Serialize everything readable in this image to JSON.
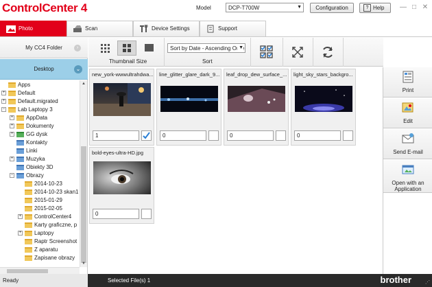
{
  "window": {
    "title_main": "ControlCenter",
    "title_version": " 4",
    "model_label": "Model",
    "model_value": "DCP-T700W",
    "configuration_label": "Configuration",
    "help_label": "Help",
    "help_glyph": "?",
    "minimize_glyph": "—",
    "maximize_glyph": "□",
    "close_glyph": "✕"
  },
  "tabs": [
    {
      "label": "Photo",
      "icon": "photo-icon",
      "active": true
    },
    {
      "label": "Scan",
      "icon": "scan-icon",
      "active": false
    },
    {
      "label": "Device Settings",
      "icon": "tools-icon",
      "active": false
    },
    {
      "label": "Support",
      "icon": "support-icon",
      "active": false
    }
  ],
  "leftpanel": {
    "cc4_folder": "My CC4 Folder",
    "desktop": "Desktop",
    "tree": [
      {
        "label": "Apps",
        "expander": "",
        "folder": "yellow"
      },
      {
        "label": "Default",
        "expander": "+",
        "folder": "yellow"
      },
      {
        "label": "Default.migrated",
        "expander": "+",
        "folder": "yellow"
      },
      {
        "label": "Lab Laptopy 3",
        "expander": "−",
        "folder": "yellow"
      },
      {
        "label": "AppData",
        "expander": "+",
        "folder": "yellow"
      },
      {
        "label": "Dokumenty",
        "expander": "+",
        "folder": "yellow"
      },
      {
        "label": "GG dysk",
        "expander": "+",
        "folder": "green"
      },
      {
        "label": "Kontakty",
        "expander": "",
        "folder": "blue"
      },
      {
        "label": "Linki",
        "expander": "",
        "folder": "blue"
      },
      {
        "label": "Muzyka",
        "expander": "+",
        "folder": "blue"
      },
      {
        "label": "Obiekty 3D",
        "expander": "",
        "folder": "blue"
      },
      {
        "label": "Obrazy",
        "expander": "−",
        "folder": "blue"
      },
      {
        "label": "2014-10-23",
        "expander": "",
        "folder": "yellow"
      },
      {
        "label": "2014-10-23 skan1",
        "expander": "",
        "folder": "yellow"
      },
      {
        "label": "2015-01-29",
        "expander": "",
        "folder": "yellow"
      },
      {
        "label": "2015-02-05",
        "expander": "",
        "folder": "yellow"
      },
      {
        "label": "ControlCenter4",
        "expander": "+",
        "folder": "yellow"
      },
      {
        "label": "Karty graficzne, p",
        "expander": "",
        "folder": "yellow"
      },
      {
        "label": "Laptopy",
        "expander": "+",
        "folder": "yellow"
      },
      {
        "label": "Raptr Screenshot",
        "expander": "",
        "folder": "yellow"
      },
      {
        "label": "Z aparatu",
        "expander": "",
        "folder": "yellow"
      },
      {
        "label": "Zapisane obrazy",
        "expander": "",
        "folder": "yellow"
      }
    ]
  },
  "toolbar": {
    "thumbnail_size_label": "Thumbnail Size",
    "sort_value": "Sort by Date - Ascending Orde",
    "sort_label": "Sort"
  },
  "thumbnails": [
    {
      "filename": "new_york-wwwultrahdwa...",
      "quantity": "1",
      "checked": true
    },
    {
      "filename": "line_glitter_glare_dark_9...",
      "quantity": "0",
      "checked": false
    },
    {
      "filename": "leaf_drop_dew_surface_...",
      "quantity": "0",
      "checked": false
    },
    {
      "filename": "light_sky_stars_backgro...",
      "quantity": "0",
      "checked": false
    },
    {
      "filename": "bold-eyes-ultra-HD.jpg",
      "quantity": "0",
      "checked": false
    }
  ],
  "rightpanel": {
    "print": "Print",
    "edit": "Edit",
    "send_email": "Send E-mail",
    "open_with": "Open with an Application"
  },
  "status": {
    "ready": "Ready",
    "selected": "Selected File(s) 1",
    "brand": "brother"
  },
  "colors": {
    "brand_red": "#e2001a",
    "selected_blue": "#9ccfe8",
    "check_blue": "#2a7fd4"
  }
}
